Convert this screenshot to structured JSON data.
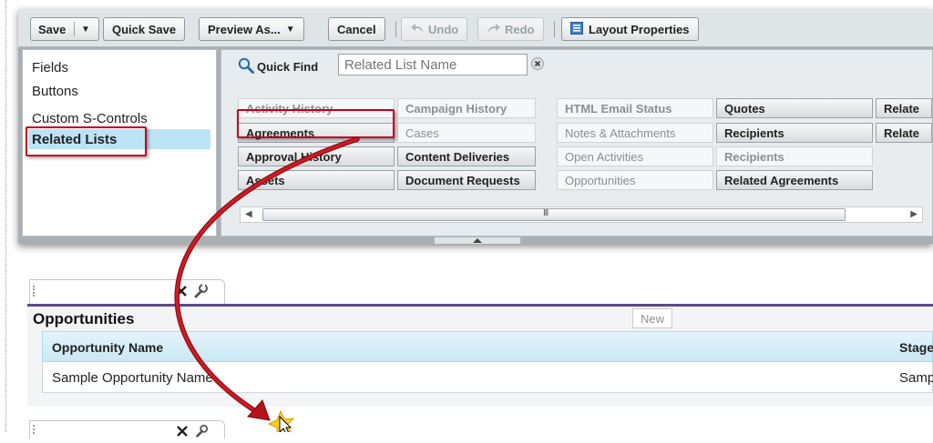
{
  "toolbar": {
    "save": "Save",
    "save_menu": "▼",
    "quick_save": "Quick Save",
    "preview_as": "Preview As...",
    "preview_menu": "▼",
    "cancel": "Cancel",
    "undo": "Undo",
    "redo": "Redo",
    "layout_properties": "Layout Properties"
  },
  "palette": {
    "categories": [
      "Fields",
      "Buttons",
      "Custom S-Controls",
      "Related Lists"
    ],
    "selected_category": "Related Lists",
    "quick_find_label": "Quick Find",
    "quick_find_placeholder": "Related List Name",
    "items": [
      [
        "Activity History",
        "Agreements",
        "Approval History",
        "Assets"
      ],
      [
        "Campaign History",
        "Cases",
        "Content Deliveries",
        "Document Requests"
      ],
      [
        "HTML Email Status",
        "Notes & Attachments",
        "Open Activities",
        "Opportunities"
      ],
      [
        "Quotes",
        "Recipients",
        "Recipients",
        "Related Agreements"
      ],
      [
        "Relate",
        "Relate"
      ]
    ],
    "scrollbar_grip": "III"
  },
  "related_list": {
    "title": "Opportunities",
    "new_button": "New",
    "columns": [
      "Opportunity Name",
      "Stage"
    ],
    "rows": [
      [
        "Sample Opportunity Name",
        "Sampl"
      ]
    ]
  },
  "colors": {
    "highlight": "#c0001a",
    "selected_bg": "#bde3f6",
    "section_divider": "#5a4a8a",
    "arrow": "#b5121b"
  }
}
